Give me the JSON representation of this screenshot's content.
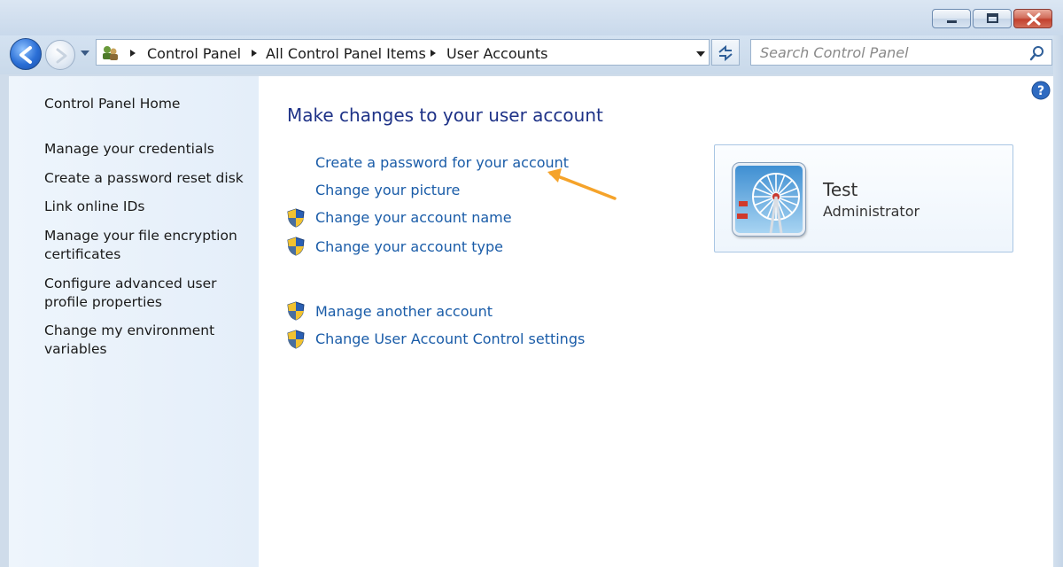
{
  "window": {
    "minimize_icon": "minimize-icon",
    "maximize_icon": "maximize-icon",
    "close_icon": "close-icon"
  },
  "navigation": {
    "back_icon": "back-arrow-icon",
    "forward_icon": "forward-arrow-icon",
    "breadcrumb": [
      "Control Panel",
      "All Control Panel Items",
      "User Accounts"
    ],
    "refresh_icon": "refresh-icon"
  },
  "search": {
    "placeholder": "Search Control Panel"
  },
  "sidebar": {
    "items": [
      {
        "label": "Control Panel Home"
      },
      {
        "label": "Manage your credentials"
      },
      {
        "label": "Create a password reset disk"
      },
      {
        "label": "Link online IDs"
      },
      {
        "label": "Manage your file encryption certificates"
      },
      {
        "label": "Configure advanced user profile properties"
      },
      {
        "label": "Change my environment variables"
      }
    ]
  },
  "main": {
    "title": "Make changes to your user account",
    "tasks": [
      {
        "label": "Create a password for your account",
        "shield": false
      },
      {
        "label": "Change your picture",
        "shield": false
      },
      {
        "label": "Change your account name",
        "shield": true
      },
      {
        "label": "Change your account type",
        "shield": true
      }
    ],
    "other_tasks": [
      {
        "label": "Manage another account",
        "shield": true
      },
      {
        "label": "Change User Account Control settings",
        "shield": true
      }
    ],
    "user": {
      "name": "Test",
      "role": "Administrator"
    }
  },
  "colors": {
    "link": "#1a5ca8",
    "title": "#1e3287",
    "annotation_arrow": "#f5a32a"
  }
}
